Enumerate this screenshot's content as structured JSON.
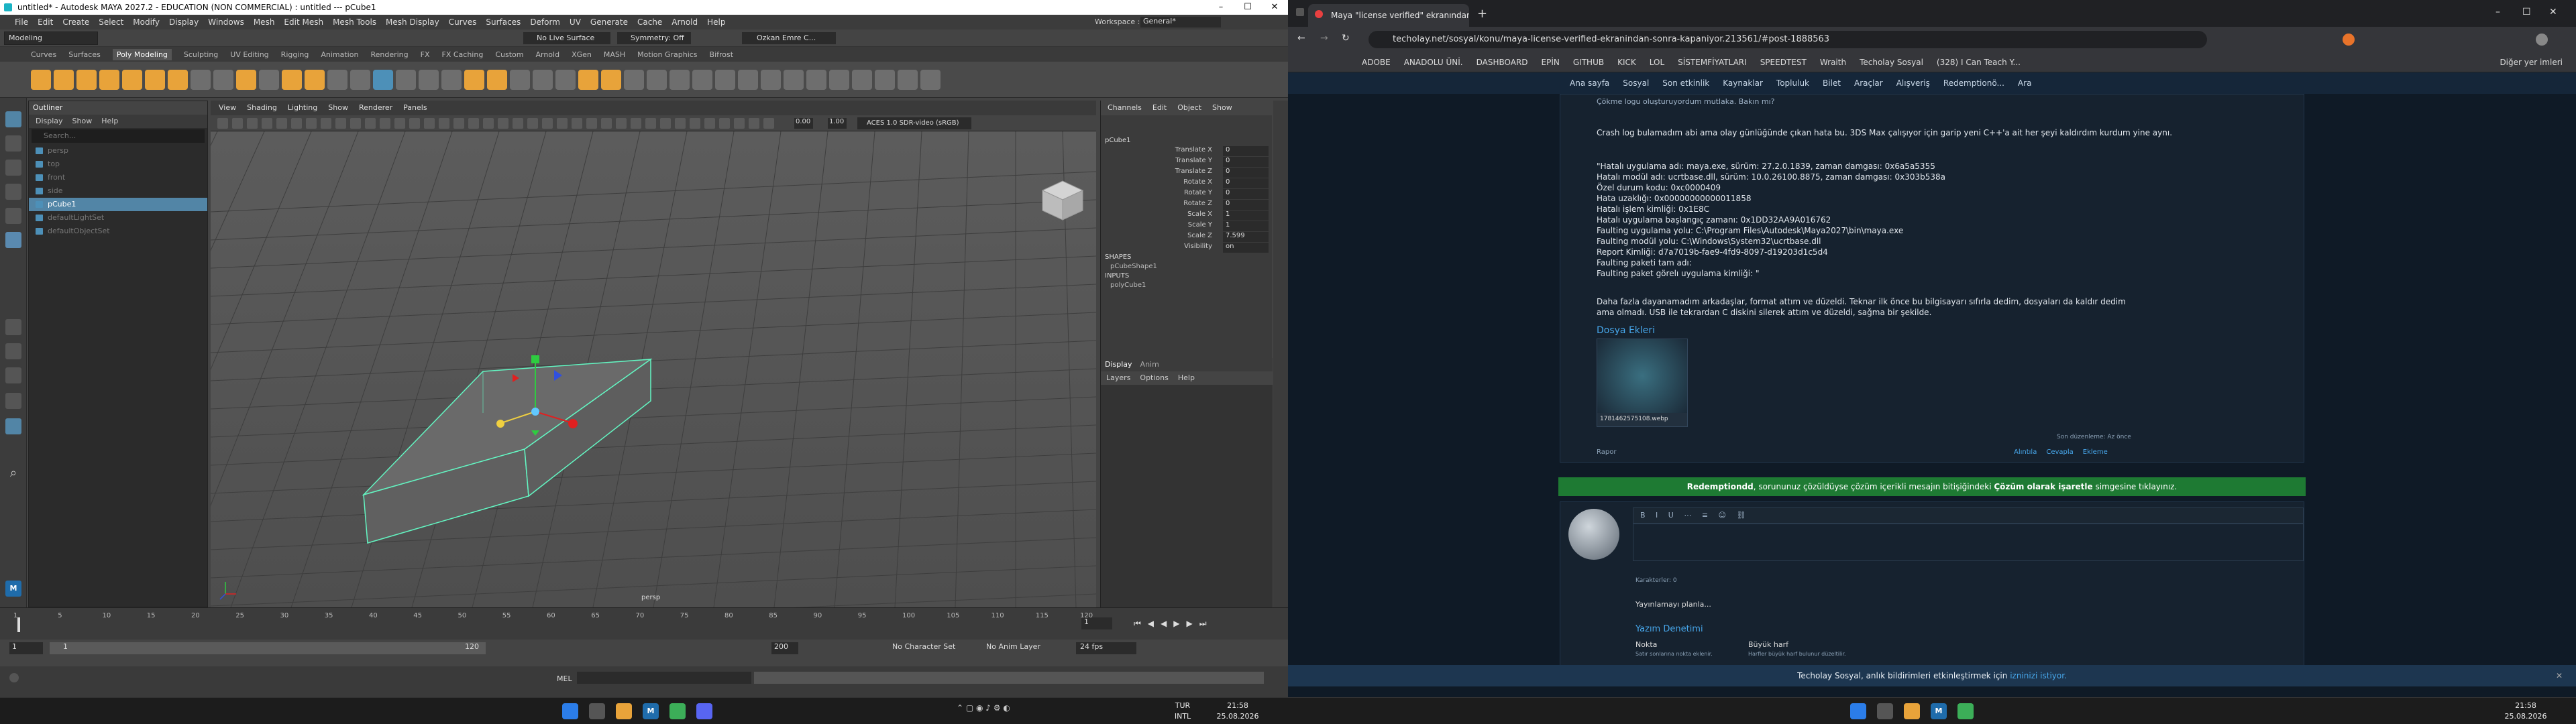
{
  "maya": {
    "title": "untitled* - Autodesk MAYA 2027.2 - EDUCATION (NON COMMERCIAL) : untitled  ---  pCube1",
    "menu": [
      "File",
      "Edit",
      "Create",
      "Select",
      "Modify",
      "Display",
      "Windows",
      "Mesh",
      "Edit Mesh",
      "Mesh Tools",
      "Mesh Display",
      "Curves",
      "Surfaces",
      "Deform",
      "UV",
      "Generate",
      "Cache",
      "Arnold",
      "Help"
    ],
    "workspace_label": "Workspace :",
    "workspace_value": "General*",
    "mode": "Modeling",
    "no_live": "No Live Surface",
    "symmetry": "Symmetry: Off",
    "user": "Ozkan Emre C...",
    "shelf_tabs": [
      "Curves",
      "Surfaces",
      "Poly Modeling",
      "Sculpting",
      "UV Editing",
      "Rigging",
      "Animation",
      "Rendering",
      "FX",
      "FX Caching",
      "Custom",
      "Arnold",
      "XGen",
      "MASH",
      "Motion Graphics",
      "Bifrost"
    ],
    "shelf_active": "Poly Modeling",
    "outliner": {
      "title": "Outliner",
      "menu": [
        "Display",
        "Show",
        "Help"
      ],
      "search": "Search...",
      "items": [
        {
          "label": "persp",
          "sel": false
        },
        {
          "label": "top",
          "sel": false
        },
        {
          "label": "front",
          "sel": false
        },
        {
          "label": "side",
          "sel": false
        },
        {
          "label": "pCube1",
          "sel": true
        },
        {
          "label": "defaultLightSet",
          "sel": false
        },
        {
          "label": "defaultObjectSet",
          "sel": false
        }
      ]
    },
    "viewport": {
      "menu": [
        "View",
        "Shading",
        "Lighting",
        "Show",
        "Renderer",
        "Panels"
      ],
      "near": "0.00",
      "far": "1.00",
      "colorspace": "ACES 1.0 SDR-video (sRGB)",
      "camera": "persp"
    },
    "channelbox": {
      "menu": [
        "Channels",
        "Edit",
        "Object",
        "Show"
      ],
      "object": "pCube1",
      "channels": [
        {
          "name": "Translate X",
          "value": "0"
        },
        {
          "name": "Translate Y",
          "value": "0"
        },
        {
          "name": "Translate Z",
          "value": "0"
        },
        {
          "name": "Rotate X",
          "value": "0"
        },
        {
          "name": "Rotate Y",
          "value": "0"
        },
        {
          "name": "Rotate Z",
          "value": "0"
        },
        {
          "name": "Scale X",
          "value": "1"
        },
        {
          "name": "Scale Y",
          "value": "1"
        },
        {
          "name": "Scale Z",
          "value": "7.599"
        },
        {
          "name": "Visibility",
          "value": "on"
        }
      ],
      "shapes_label": "SHAPES",
      "shape": "pCubeShape1",
      "inputs_label": "INPUTS",
      "input": "polyCube1",
      "layer_tabs": [
        "Display",
        "Anim"
      ],
      "layer_menu": [
        "Layers",
        "Options",
        "Help"
      ]
    },
    "timeline": {
      "ticks": [
        "1",
        "5",
        "10",
        "15",
        "20",
        "25",
        "30",
        "35",
        "40",
        "45",
        "50",
        "55",
        "60",
        "65",
        "70",
        "75",
        "80",
        "85",
        "90",
        "95",
        "100",
        "105",
        "110",
        "115",
        "120"
      ],
      "current": "1"
    },
    "range": {
      "start": "1",
      "inner_start": "1",
      "inner_end": "120",
      "end": "200",
      "char_set": "No Character Set",
      "anim_layer": "No Anim Layer",
      "fps": "24 fps"
    },
    "cmd_label": "MEL"
  },
  "browser": {
    "tab_title": "Maya \"license verified\" ekranından",
    "url": "techolay.net/sosyal/konu/maya-license-verified-ekranindan-sonra-kapaniyor.213561/#post-1888563",
    "bookmarks": [
      "ADOBE",
      "ANADOLU ÜNİ.",
      "DASHBOARD",
      "EPİN",
      "GITHUB",
      "KICK",
      "LOL",
      "SİSTEMFİYATLARI",
      "SPEEDTEST",
      "Wraith",
      "Techolay Sosyal",
      "(328) I Can Teach Y..."
    ],
    "bookmarks_more": "Diğer yer imleri",
    "nav": [
      "Ana sayfa",
      "Sosyal",
      "Son etkinlik",
      "Kaynaklar",
      "Topluluk",
      "Bilet",
      "Araçlar",
      "Alışveriş",
      "Redemptionö...",
      "Ara"
    ],
    "post": {
      "top_line": "Çökme logu oluşturuyordum mutlaka. Bakın mı?",
      "p1": "Crash log bulamadım abi ama olay günlüğünde çıkan hata bu. 3DS Max çalışıyor için garip yeni C++'a ait her şeyi kaldırdım kurdum yine aynı.",
      "log": [
        "\"Hatalı uygulama adı: maya.exe, sürüm: 27.2.0.1839, zaman damgası: 0x6a5a5355",
        "Hatalı modül adı: ucrtbase.dll, sürüm: 10.0.26100.8875, zaman damgası: 0x303b538a",
        "Özel durum kodu: 0xc0000409",
        "Hata uzaklığı: 0x00000000000011858",
        "Hatalı işlem kimliği: 0x1E8C",
        "Hatalı uygulama başlangıç zamanı: 0x1DD32AA9A016762",
        "Faulting uygulama yolu: C:\\Program Files\\Autodesk\\Maya2027\\bin\\maya.exe",
        "Faulting modül yolu: C:\\Windows\\System32\\ucrtbase.dll",
        "Report Kimliği: d7a7019b-fae9-4fd9-8097-d19203d1c5d4",
        "Faulting paketi tam adı:",
        "Faulting paket görelı uygulama kimliği: \""
      ],
      "p2": "Daha fazla dayanamadım arkadaşlar, format attım ve düzeldi. Teknar ilk önce bu bilgisayarı sıfırla dedim, dosyaları da kaldır dedim",
      "p3": "ama olmadı. USB ile tekrardan C diskini silerek attım ve düzeldi, sağma bir şekilde.",
      "attach_title": "Dosya Ekleri",
      "attach_name": "1781462575108.webp",
      "edited": "Son düzenleme: Az önce",
      "report": "Rapor",
      "actions": [
        "Alıntıla",
        "Cevapla",
        "Ekleme"
      ]
    },
    "solved_a": "Redemptiondd",
    "solved_b": ", sorununuz çözüldüyse çözüm içerikli mesajın bitişiğindeki ",
    "solved_c": "Çözüm olarak işaretle",
    "solved_d": " simgesine tıklayınız.",
    "reply": {
      "chars": "Karakterler: 0",
      "poll": "Yayınlamayı planla...",
      "title": "Yazım Denetimi",
      "opt1": "Nokta",
      "opt1s": "Satır sonlarına nokta eklenir.",
      "opt2": "Büyük harf",
      "opt2s": "Harfler büyük harf bulunur düzeltilir."
    },
    "cookie_a": "Techolay Sosyal, anlık bildirimleri etkinleştirmek için ",
    "cookie_b": "izninizi istiyor."
  },
  "taskbar": {
    "lang_a": "TUR",
    "lang_b": "INTL",
    "time": "21:58",
    "date": "25.08.2026"
  }
}
